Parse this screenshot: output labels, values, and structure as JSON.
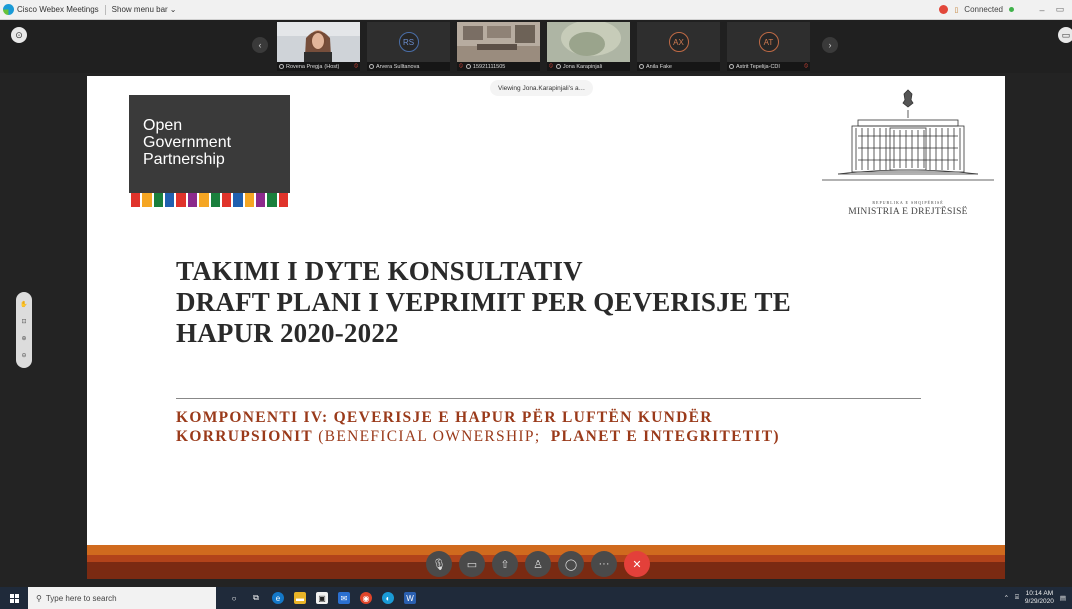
{
  "window": {
    "app_title": "Cisco Webex Meetings",
    "menu_toggle": "Show menu bar",
    "status": "Connected"
  },
  "participants": [
    {
      "name": "Rovena Pregja",
      "role": "Host",
      "type": "video",
      "muted": true
    },
    {
      "name": "Arvera Sulltanova",
      "initials": "RS",
      "type": "avatar",
      "muted": false
    },
    {
      "name": "15921111505",
      "type": "video",
      "muted": true
    },
    {
      "name": "Jona Karapinjali",
      "type": "video",
      "muted": false
    },
    {
      "name": "Anila Fake",
      "initials": "AX",
      "type": "avatar",
      "muted": false
    },
    {
      "name": "Astrit Tepelija-CDI",
      "initials": "AT",
      "type": "avatar",
      "muted": true
    }
  ],
  "share": {
    "viewing_label": "Viewing Jona.Karapinjali's a…"
  },
  "slide": {
    "logo_lines": [
      "Open",
      "Government",
      "Partnership"
    ],
    "logo_stripe_colors": [
      "#e0332b",
      "#f5a623",
      "#1a7f3c",
      "#2060b0",
      "#e0332b",
      "#8c2a8c",
      "#f5a623",
      "#1a7f3c",
      "#e0332b",
      "#2060b0",
      "#f5a623",
      "#8c2a8c",
      "#1a7f3c",
      "#e0332b"
    ],
    "ministry_small": "REPUBLIKA E SHQIPËRISË",
    "ministry_name": "MINISTRIA E DREJTËSISË",
    "title_line1": "TAKIMI I DYTE KONSULTATIV",
    "title_line2": "DRAFT PLANI I VEPRIMIT PER QEVERISJE TE",
    "title_line3": "HAPUR 2020-2022",
    "component_line1": "KOMPONENTI IV: QEVERISJE E HAPUR PËR LUFTËN KUNDËR",
    "component_line2_a": "KORRUPSIONIT",
    "component_line2_b": " (BENEFICIAL OWNERSHIP;  ",
    "component_line2_c": "PLANET E INTEGRITETIT)"
  },
  "controls": [
    "mute-icon",
    "video-icon",
    "share-icon",
    "participants-icon",
    "chat-icon",
    "more-icon",
    "end-call-icon"
  ],
  "taskbar": {
    "search_placeholder": "Type here to search",
    "time": "10:14 AM",
    "date": "9/29/2020"
  }
}
